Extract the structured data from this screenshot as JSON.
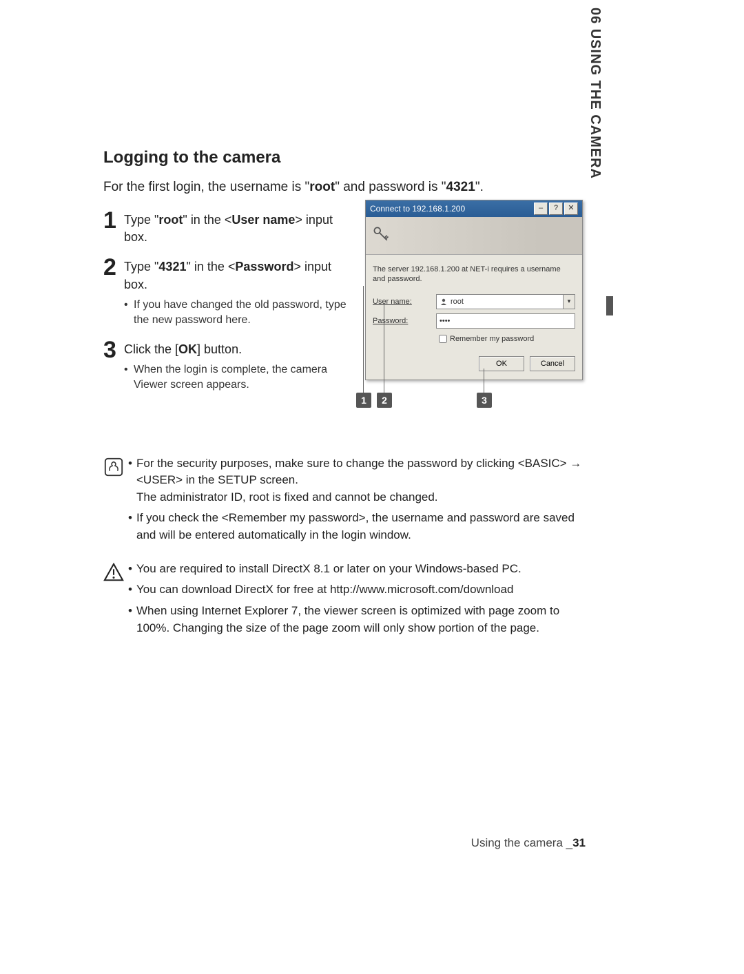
{
  "side_tab": "06  USING THE CAMERA",
  "section_title": "Logging to the camera",
  "intro_parts": {
    "p1": "For the first login, the username is \"",
    "b1": "root",
    "p2": "\" and password is \"",
    "b2": "4321",
    "p3": "\"."
  },
  "steps": [
    {
      "num": "1",
      "text_pre": "Type \"",
      "text_b1": "root",
      "text_mid": "\" in the <",
      "text_b2": "User name",
      "text_post": "> input box.",
      "subs": []
    },
    {
      "num": "2",
      "text_pre": "Type \"",
      "text_b1": "4321",
      "text_mid": "\" in the <",
      "text_b2": "Password",
      "text_post": "> input box.",
      "subs": [
        "If you have changed the old password, type the new password here."
      ]
    },
    {
      "num": "3",
      "text_pre": "Click the [",
      "text_b1": "OK",
      "text_mid": "",
      "text_b2": "",
      "text_post": "] button.",
      "subs": [
        "When the login is complete, the camera Viewer screen appears."
      ]
    }
  ],
  "dialog": {
    "title": "Connect to 192.168.1.200",
    "msg": "The server 192.168.1.200  at NET-i requires a username and password.",
    "user_label": "User name:",
    "user_value": "root",
    "pass_label": "Password:",
    "pass_value": "••••",
    "remember": "Remember my password",
    "ok": "OK",
    "cancel": "Cancel",
    "callouts": [
      "1",
      "2",
      "3"
    ]
  },
  "notes": [
    {
      "icon": "info",
      "items": [
        "For the security purposes, make sure to change the password by clicking <BASIC> → <USER> in the SETUP screen.\nThe administrator ID, root is fixed and cannot be changed.",
        "If you check the <Remember my password>, the username and password are saved and will be entered automatically in the login window."
      ]
    },
    {
      "icon": "warning",
      "items": [
        "You are required to install DirectX 8.1 or later on your Windows-based PC.",
        "You can download DirectX for free at http://www.microsoft.com/download",
        "When using Internet Explorer 7, the viewer screen is optimized with page zoom to 100%. Changing the size of the page zoom will only show portion of the page."
      ]
    }
  ],
  "footer": {
    "label": "Using the camera _",
    "page": "31"
  }
}
